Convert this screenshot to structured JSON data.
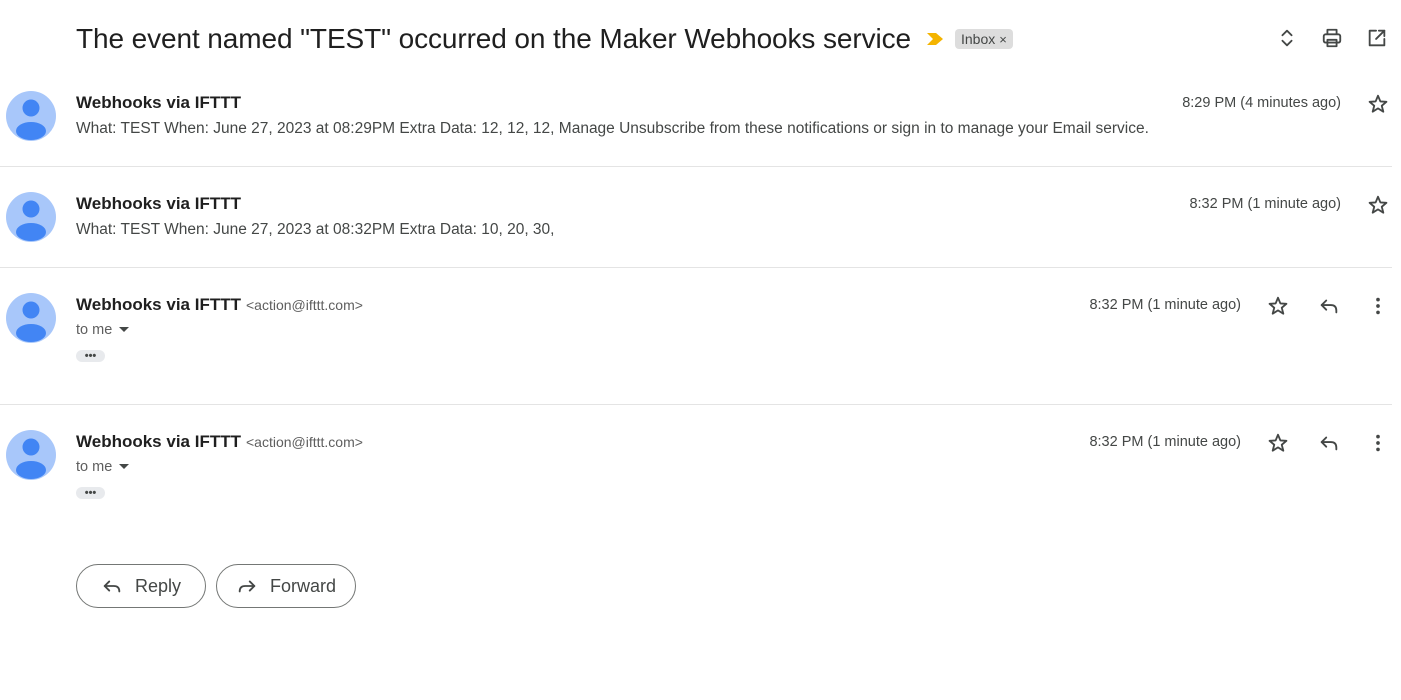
{
  "subject": "The event named \"TEST\" occurred on the Maker Webhooks service",
  "label_chip": {
    "text": "Inbox",
    "close": "×"
  },
  "top_actions": [
    "expand-all-icon",
    "print-icon",
    "open-in-new-window-icon"
  ],
  "colors": {
    "importance_marker": "#f4b400",
    "avatar_bg": "#a8c7fa",
    "avatar_fg": "#4285f4",
    "chip_bg": "#dddddd"
  },
  "messages": [
    {
      "sender": "Webhooks via IFTTT",
      "time": "8:29 PM (4 minutes ago)",
      "snippet": "What: TEST When: June 27, 2023 at 08:29PM Extra Data: 12, 12, 12, Manage Unsubscribe from these notifications or sign in to manage your Email service."
    },
    {
      "sender": "Webhooks via IFTTT",
      "time": "8:32 PM (1 minute ago)",
      "snippet": "What: TEST When: June 27, 2023 at 08:32PM Extra Data: 10, 20, 30,"
    },
    {
      "sender": "Webhooks via IFTTT",
      "email": "<action@ifttt.com>",
      "time": "8:32 PM (1 minute ago)",
      "to": "to me",
      "trimmed": "•••"
    },
    {
      "sender": "Webhooks via IFTTT",
      "email": "<action@ifttt.com>",
      "time": "8:32 PM (1 minute ago)",
      "to": "to me",
      "trimmed": "•••"
    }
  ],
  "buttons": {
    "reply": "Reply",
    "forward": "Forward"
  }
}
